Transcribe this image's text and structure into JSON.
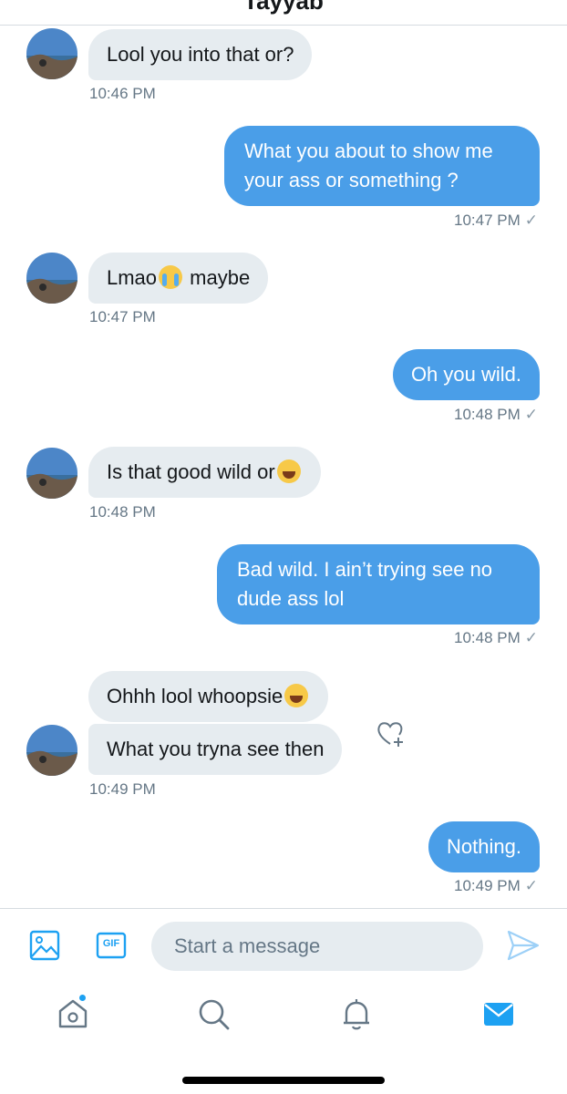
{
  "header": {
    "title": "Tayyab"
  },
  "messages": [
    {
      "dir": "in",
      "text": "Lool you into that or?",
      "time": "10:46 PM"
    },
    {
      "dir": "out",
      "text": "What you about to show me your ass or something ?",
      "time": "10:47 PM"
    },
    {
      "dir": "in",
      "text_a": "Lmao",
      "emoji": "loudly-crying-face",
      "text_b": " maybe",
      "time": "10:47 PM"
    },
    {
      "dir": "out",
      "text": "Oh you wild.",
      "time": "10:48 PM"
    },
    {
      "dir": "in",
      "text": "Is that good wild or",
      "emoji": "face-with-tears-of-joy",
      "time": "10:48 PM"
    },
    {
      "dir": "out",
      "text": "Bad wild. I ain’t trying see no dude ass lol",
      "time": "10:48 PM"
    },
    {
      "dir": "in",
      "text": "Ohhh lool whoopsie",
      "emoji": "face-with-tears-of-joy"
    },
    {
      "dir": "in",
      "text": "What you tryna see then",
      "time": "10:49 PM"
    },
    {
      "dir": "out",
      "text": "Nothing.",
      "time": "10:49 PM"
    }
  ],
  "read_mark": "✓",
  "composer": {
    "placeholder": "Start a message",
    "gif_label": "GIF"
  },
  "tabs": [
    "home",
    "search",
    "notifications",
    "messages"
  ],
  "colors": {
    "accent": "#1da1f2",
    "outgoing_bubble": "#4a9ee8",
    "incoming_bubble": "#e6ecf0",
    "timestamp": "#657786"
  }
}
